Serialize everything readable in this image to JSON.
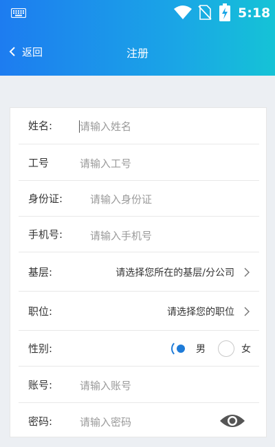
{
  "status_bar": {
    "time": "5:18"
  },
  "nav": {
    "back_label": "返回",
    "title": "注册"
  },
  "form": {
    "name": {
      "label": "姓名:",
      "placeholder": "请输入姓名"
    },
    "employee_id": {
      "label": "工号",
      "placeholder": "请输入工号"
    },
    "id_card": {
      "label": "身份证:",
      "placeholder": "请输入身份证"
    },
    "phone": {
      "label": "手机号:",
      "placeholder": "请输入手机号"
    },
    "branch": {
      "label": "基层:",
      "value": "请选择您所在的基层/分公司"
    },
    "position": {
      "label": "职位:",
      "value": "请选择您的职位"
    },
    "gender": {
      "label": "性别:",
      "options": [
        "男",
        "女"
      ],
      "selected": "男"
    },
    "account": {
      "label": "账号:",
      "placeholder": "请输入账号"
    },
    "password": {
      "label": "密码:",
      "placeholder": "请输入密码"
    }
  },
  "colors": {
    "header_start": "#1d7cf0",
    "header_end": "#15c3d6",
    "accent": "#1e7bd8"
  }
}
